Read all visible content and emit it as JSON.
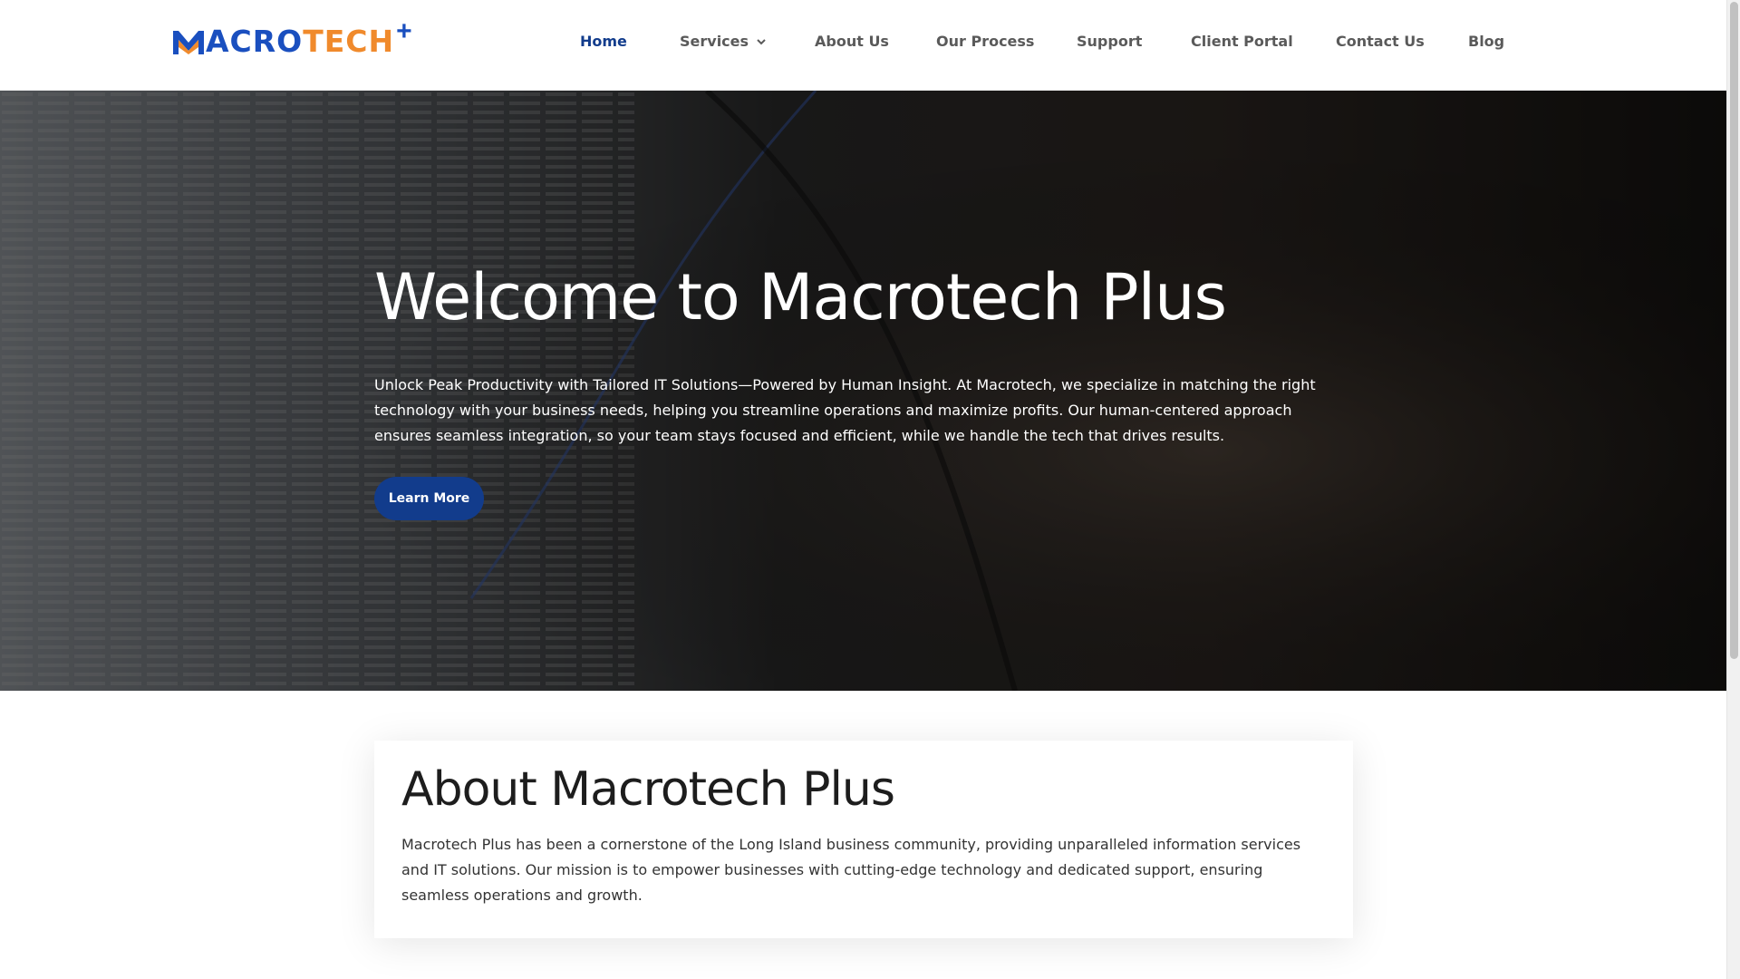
{
  "brand": {
    "logo_part1": "ACRO",
    "logo_part2": "TECH",
    "logo_plus": "+",
    "colors": {
      "primary": "#1a4fbf",
      "accent": "#f08a2c",
      "nav_active": "#123c8c"
    }
  },
  "nav": {
    "items": [
      {
        "label": "Home",
        "active": true
      },
      {
        "label": "Services",
        "has_dropdown": true
      },
      {
        "label": "About Us"
      },
      {
        "label": "Our Process"
      },
      {
        "label": "Support"
      },
      {
        "label": "Client Portal"
      },
      {
        "label": "Contact Us"
      },
      {
        "label": "Blog"
      }
    ]
  },
  "hero": {
    "title": "Welcome to Macrotech Plus",
    "text": "Unlock Peak Productivity with Tailored IT Solutions—Powered by Human Insight. At Macrotech, we specialize in matching the right technology with your business needs, helping you streamline operations and maximize profits. Our human-centered approach ensures seamless integration, so your team stays focused and efficient, while we handle the tech that drives results.",
    "button_label": "Learn More"
  },
  "about": {
    "title": "About Macrotech Plus",
    "text": "Macrotech Plus has been a cornerstone of the Long Island business community, providing unparalleled information services and IT solutions. Our mission is to empower businesses with cutting-edge technology and dedicated support, ensuring seamless operations and growth."
  }
}
